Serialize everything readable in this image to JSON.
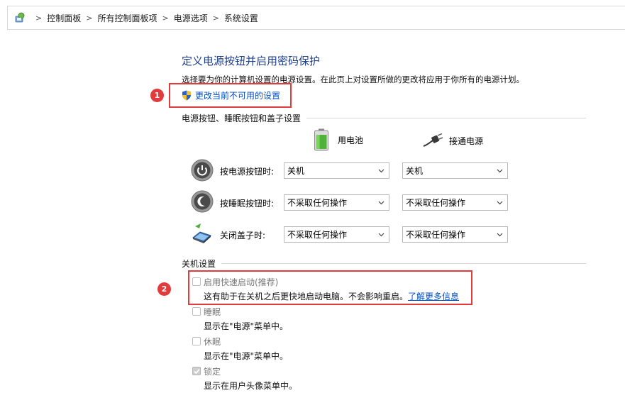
{
  "breadcrumb": {
    "items": [
      "控制面板",
      "所有控制面板项",
      "电源选项",
      "系统设置"
    ],
    "separator": ">"
  },
  "page": {
    "title": "定义电源按钮并启用密码保护",
    "description": "选择要为你的计算机设置的电源设置。在此页上对设置所做的更改将应用于你所有的电源计划。",
    "change_link": "更改当前不可用的设置"
  },
  "power_section": {
    "heading": "电源按钮、睡眠按钮和盖子设置",
    "battery_label": "用电池",
    "plugged_label": "接通电源",
    "rows": [
      {
        "label": "按电源按钮时:",
        "battery": "关机",
        "plugged": "关机",
        "icon": "power-button-icon"
      },
      {
        "label": "按睡眠按钮时:",
        "battery": "不采取任何操作",
        "plugged": "不采取任何操作",
        "icon": "sleep-button-icon"
      },
      {
        "label": "关闭盖子时:",
        "battery": "不采取任何操作",
        "plugged": "不采取任何操作",
        "icon": "laptop-lid-icon"
      }
    ]
  },
  "shutdown_section": {
    "heading": "关机设置",
    "items": [
      {
        "label": "启用快速启动(推荐)",
        "desc": "这有助于在关机之后更快地启动电脑。不会影响重启。",
        "link": "了解更多信息",
        "checked": false
      },
      {
        "label": "睡眠",
        "desc": "显示在\"电源\"菜单中。",
        "checked": false
      },
      {
        "label": "休眠",
        "desc": "显示在\"电源\"菜单中。",
        "checked": false
      },
      {
        "label": "锁定",
        "desc": "显示在用户头像菜单中。",
        "checked": true
      }
    ]
  },
  "annotations": {
    "marker1": "1",
    "marker2": "2"
  },
  "colors": {
    "title": "#1e3f8f",
    "link": "#0050c8",
    "highlight": "#e23b3b"
  }
}
